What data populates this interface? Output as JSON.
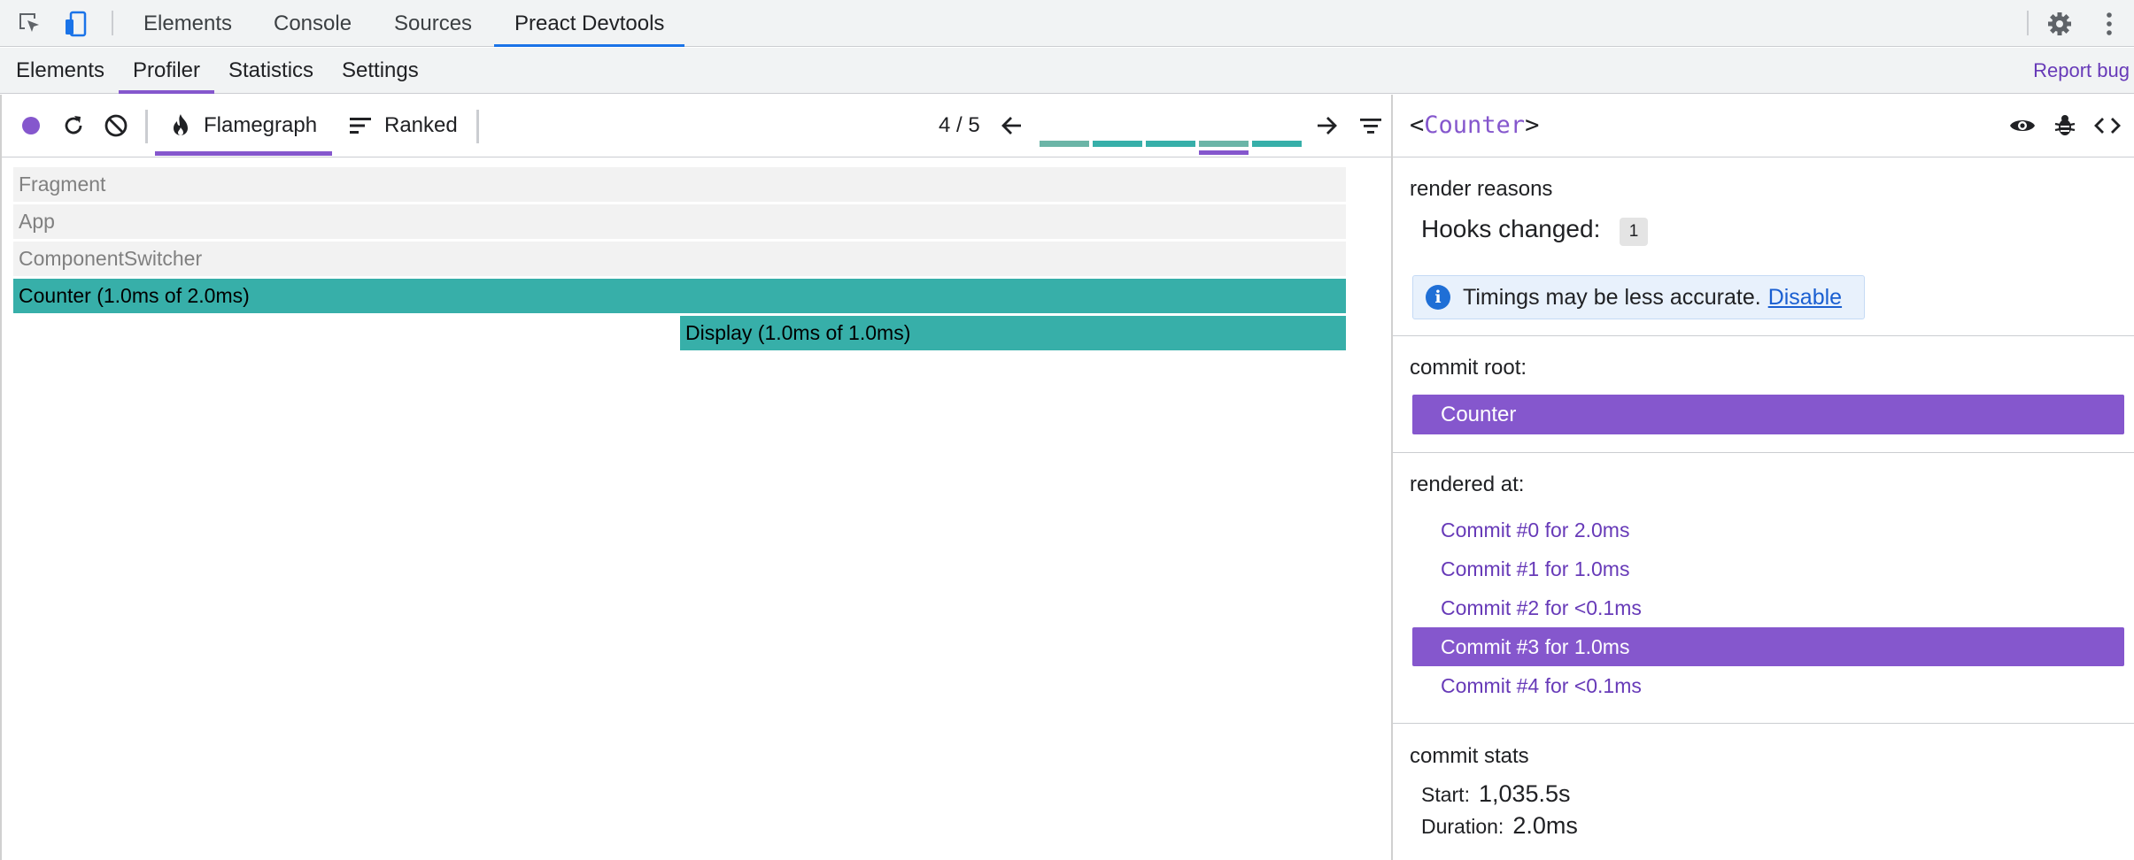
{
  "devtools_tabs": [
    "Elements",
    "Console",
    "Sources",
    "Preact Devtools"
  ],
  "preact_tabs": [
    "Elements",
    "Profiler",
    "Statistics",
    "Settings"
  ],
  "report_bug": "Report bug",
  "toolbar": {
    "flamegraph_label": "Flamegraph",
    "ranked_label": "Ranked",
    "commit_position": "4 / 5"
  },
  "commit_bars": [
    {
      "color": "#6bb5a7",
      "selected": false
    },
    {
      "color": "#37afa9",
      "selected": false
    },
    {
      "color": "#37afa9",
      "selected": false
    },
    {
      "color": "#6bb5a7",
      "selected": true
    },
    {
      "color": "#37afa9",
      "selected": false
    }
  ],
  "flamegraph": [
    {
      "label": "Fragment",
      "kind": "grey"
    },
    {
      "label": "App",
      "kind": "grey"
    },
    {
      "label": "ComponentSwitcher",
      "kind": "grey"
    },
    {
      "label": "Counter (1.0ms of 2.0ms)",
      "kind": "teal"
    },
    {
      "label": "Display (1.0ms of 1.0ms)",
      "kind": "teal"
    }
  ],
  "sidebar": {
    "component": {
      "open": "<",
      "name": "Counter",
      "close": ">"
    },
    "render_reasons": {
      "title": "render reasons",
      "hooks_label": "Hooks changed:",
      "hooks_count": "1",
      "notice_text": "Timings may be less accurate.",
      "notice_link": "Disable"
    },
    "commit_root": {
      "title": "commit root:",
      "value": "Counter"
    },
    "rendered_at": {
      "title": "rendered at:",
      "commits": [
        "Commit #0 for 2.0ms",
        "Commit #1 for 1.0ms",
        "Commit #2 for <0.1ms",
        "Commit #3 for 1.0ms",
        "Commit #4 for <0.1ms"
      ],
      "selected_index": 3
    },
    "commit_stats": {
      "title": "commit stats",
      "start_label": "Start:",
      "start_value": "1,035.5s",
      "duration_label": "Duration:",
      "duration_value": "2.0ms"
    }
  },
  "colors": {
    "accent": "#8557cd",
    "flame_teal": "#37afa9",
    "link_blue": "#1a73e8"
  }
}
